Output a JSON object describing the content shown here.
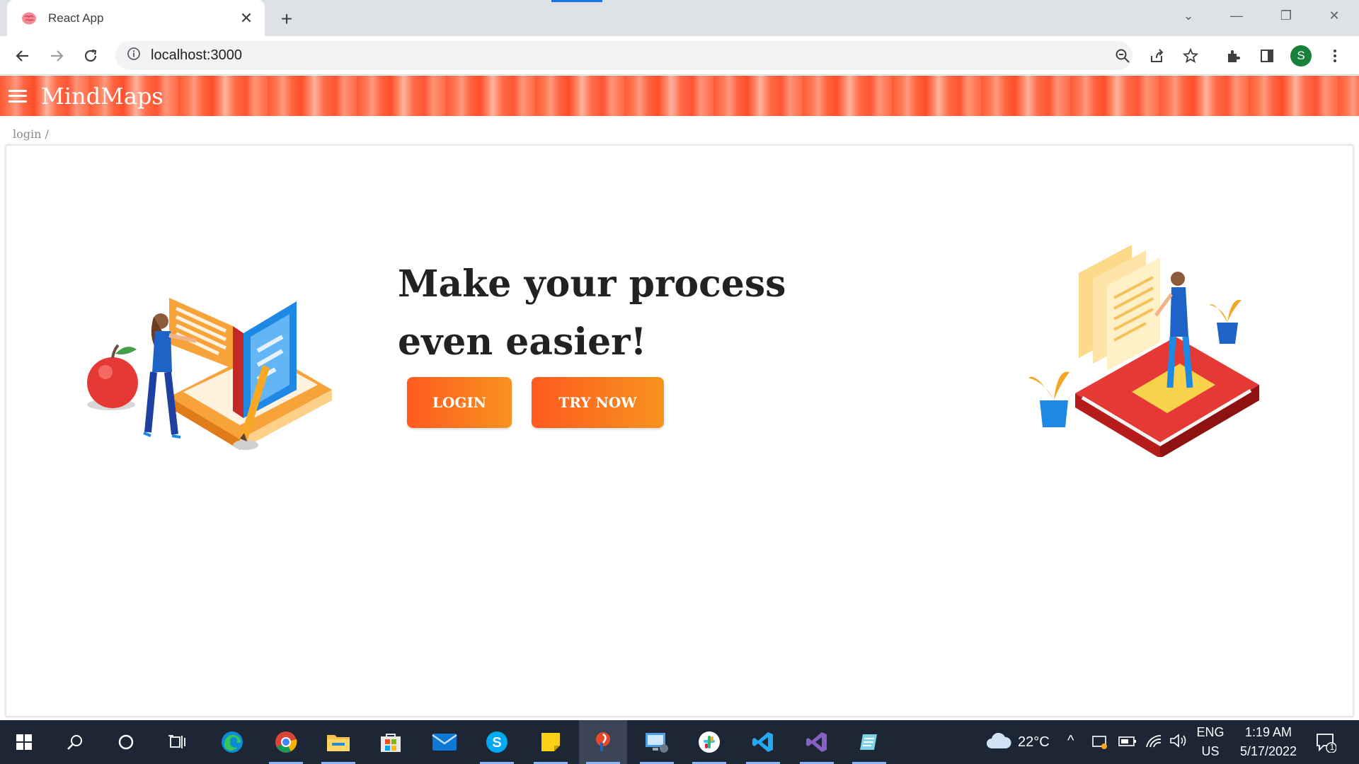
{
  "browser": {
    "tab_title": "React App",
    "url": "localhost:3000",
    "profile_initial": "S"
  },
  "app": {
    "brand": "MindMaps",
    "breadcrumb": "login /",
    "hero_title": "Make your process even easier!",
    "login_label": "LOGIN",
    "try_now_label": "TRY NOW"
  },
  "taskbar": {
    "weather_temp": "22°C",
    "lang_primary": "ENG",
    "lang_secondary": "US",
    "time": "1:19 AM",
    "date": "5/17/2022",
    "notification_count": "1"
  },
  "colors": {
    "accent_orange": "#ff5a1f",
    "accent_amber": "#f7931e",
    "header_red": "#ff5a36",
    "chrome_blue": "#1a73e8"
  }
}
